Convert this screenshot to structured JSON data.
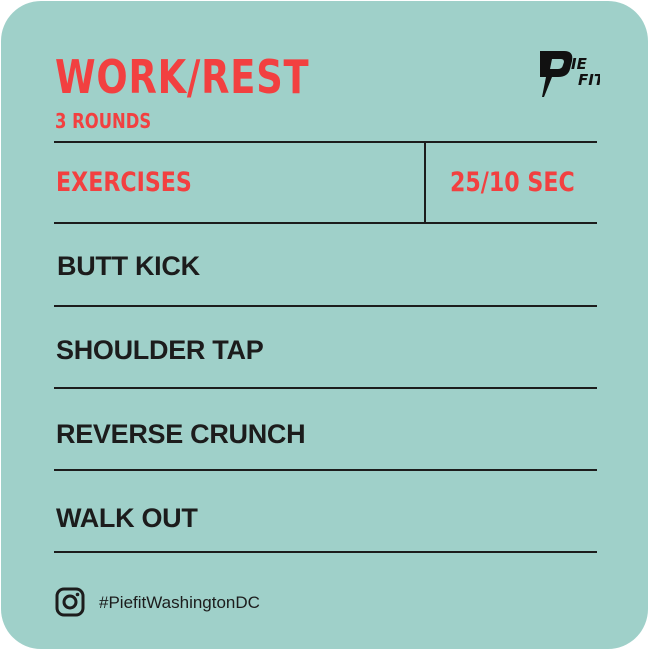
{
  "header": {
    "title": "WORK/REST",
    "subtitle": "3 ROUNDS",
    "logo_text": "PIE FIT"
  },
  "table": {
    "column_exercises": "EXERCISES",
    "column_timing": "25/10 SEC",
    "rows": [
      "BUTT KICK",
      "SHOULDER TAP",
      "REVERSE CRUNCH",
      "WALK OUT"
    ]
  },
  "footer": {
    "icon": "instagram-icon",
    "hashtag": "#PiefitWashingtonDC"
  },
  "colors": {
    "background": "#9fd0c9",
    "accent": "#f24040",
    "ink": "#1c1c1c"
  }
}
